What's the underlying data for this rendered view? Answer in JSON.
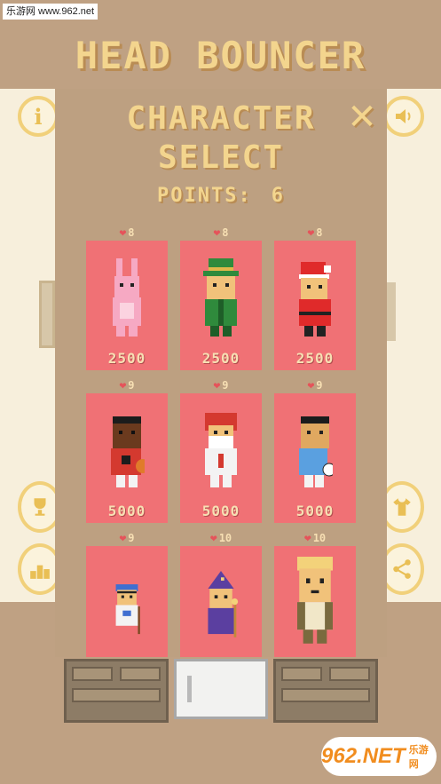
{
  "watermark_top": "乐游网 www.962.net",
  "game_title": "HEAD BOUNCER",
  "side_buttons": {
    "info_icon": "info-icon",
    "sound_icon": "speaker-icon"
  },
  "modal": {
    "title_line1": "CHARACTER",
    "title_line2": "SELECT",
    "close_label": "✕",
    "points_label": "POINTS:",
    "points_value": "6"
  },
  "characters": [
    {
      "id": "bunny",
      "lives": "8",
      "price": "2500",
      "colors": {
        "body": "#f6a9c3",
        "head": "#f6a9c3",
        "hat": "#f6a9c3"
      }
    },
    {
      "id": "leprechaun",
      "lives": "8",
      "price": "2500",
      "colors": {
        "body": "#2f8a3c",
        "head": "#f1c27a",
        "hat": "#2f8a3c"
      }
    },
    {
      "id": "santa",
      "lives": "8",
      "price": "2500",
      "colors": {
        "body": "#e02a2a",
        "head": "#f1c27a",
        "hat": "#e02a2a"
      }
    },
    {
      "id": "basketball",
      "lives": "9",
      "price": "5000",
      "colors": {
        "body": "#d4392f",
        "head": "#6b3a1e",
        "hat": "#1c1c1c"
      }
    },
    {
      "id": "football",
      "lives": "9",
      "price": "5000",
      "colors": {
        "body": "#f3f3f3",
        "head": "#f1c27a",
        "hat": "#d4392f"
      }
    },
    {
      "id": "soccer",
      "lives": "9",
      "price": "5000",
      "colors": {
        "body": "#5aa0e0",
        "head": "#e0a860",
        "hat": "#1c1c1c"
      }
    },
    {
      "id": "hockey",
      "lives": "9",
      "price": "",
      "colors": {
        "body": "#f3f3f3",
        "head": "#f1c27a",
        "hat": "#3f6fd0"
      }
    },
    {
      "id": "wizard",
      "lives": "10",
      "price": "",
      "colors": {
        "body": "#5b3fa0",
        "head": "#f1c27a",
        "hat": "#5b3fa0"
      }
    },
    {
      "id": "blonde",
      "lives": "10",
      "price": "",
      "colors": {
        "body": "#7a6a3e",
        "head": "#f1c27a",
        "hat": "#f3d27a"
      }
    }
  ],
  "watermark_bottom": {
    "logo": "962.NET",
    "sub": "乐游网"
  }
}
